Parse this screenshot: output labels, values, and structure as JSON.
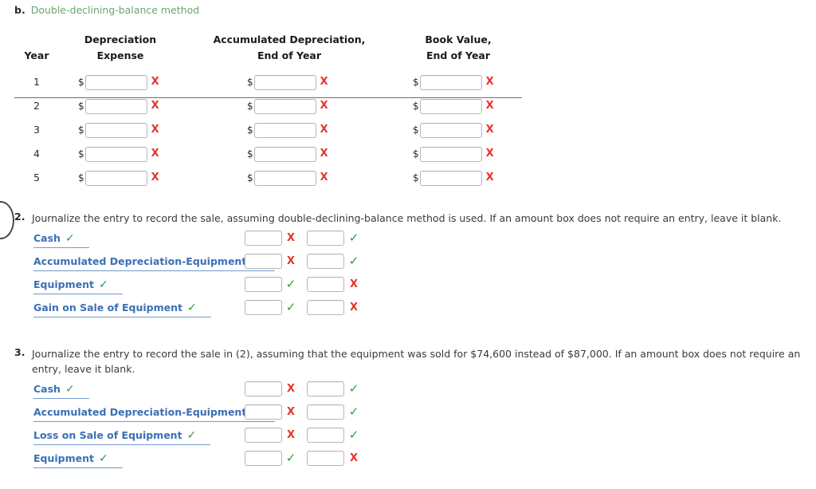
{
  "part_b": {
    "letter": "b.",
    "title": "Double-declining-balance method"
  },
  "dep_table": {
    "headers": {
      "year": {
        "line1": "",
        "line2": "Year"
      },
      "depreciation_expense": {
        "line1": "Depreciation",
        "line2": "Expense"
      },
      "accumulated_depreciation": {
        "line1": "Accumulated Depreciation,",
        "line2": "End of Year"
      },
      "book_value": {
        "line1": "Book Value,",
        "line2": "End of Year"
      }
    },
    "currency_symbol": "$",
    "rows": [
      {
        "year": "1",
        "expense_value": "",
        "expense_mark": "x",
        "accum_value": "",
        "accum_mark": "x",
        "book_value": "",
        "book_mark": "x"
      },
      {
        "year": "2",
        "expense_value": "",
        "expense_mark": "x",
        "accum_value": "",
        "accum_mark": "x",
        "book_value": "",
        "book_mark": "x"
      },
      {
        "year": "3",
        "expense_value": "",
        "expense_mark": "x",
        "accum_value": "",
        "accum_mark": "x",
        "book_value": "",
        "book_mark": "x"
      },
      {
        "year": "4",
        "expense_value": "",
        "expense_mark": "x",
        "accum_value": "",
        "accum_mark": "x",
        "book_value": "",
        "book_mark": "x"
      },
      {
        "year": "5",
        "expense_value": "",
        "expense_mark": "x",
        "accum_value": "",
        "accum_mark": "x",
        "book_value": "",
        "book_mark": "x"
      }
    ]
  },
  "question2": {
    "number": "2.",
    "text": "Journalize the entry to record the sale, assuming double-declining-balance method is used. If an amount box does not require an entry, leave it blank.",
    "entries": [
      {
        "account": "Cash",
        "account_mark": "check",
        "debit_value": "",
        "debit_mark": "x",
        "credit_value": "",
        "credit_mark": "check"
      },
      {
        "account": "Accumulated Depreciation-Equipment",
        "account_mark": "check",
        "debit_value": "",
        "debit_mark": "x",
        "credit_value": "",
        "credit_mark": "check"
      },
      {
        "account": "Equipment",
        "account_mark": "check",
        "debit_value": "",
        "debit_mark": "check",
        "credit_value": "",
        "credit_mark": "x"
      },
      {
        "account": "Gain on Sale of Equipment",
        "account_mark": "check",
        "debit_value": "",
        "debit_mark": "check",
        "credit_value": "",
        "credit_mark": "x"
      }
    ]
  },
  "question3": {
    "number": "3.",
    "text": "Journalize the entry to record the sale in (2), assuming that the equipment was sold for $74,600 instead of $87,000. If an amount box does not require an entry, leave it blank.",
    "entries": [
      {
        "account": "Cash",
        "account_mark": "check",
        "debit_value": "",
        "debit_mark": "x",
        "credit_value": "",
        "credit_mark": "check"
      },
      {
        "account": "Accumulated Depreciation-Equipment",
        "account_mark": "check",
        "debit_value": "",
        "debit_mark": "x",
        "credit_value": "",
        "credit_mark": "check"
      },
      {
        "account": "Loss on Sale of Equipment",
        "account_mark": "check",
        "debit_value": "",
        "debit_mark": "x",
        "credit_value": "",
        "credit_mark": "check"
      },
      {
        "account": "Equipment",
        "account_mark": "check",
        "debit_value": "",
        "debit_mark": "check",
        "credit_value": "",
        "credit_mark": "x"
      }
    ]
  },
  "glyphs": {
    "incorrect": "X",
    "correct": "✓"
  },
  "colors": {
    "heading_green": "#6da46d",
    "link_blue": "#3a6fb5",
    "mark_red": "#e8332a",
    "mark_green": "#2e9b3f",
    "text": "#3a3a3a",
    "rule": "#6f6f6f"
  }
}
